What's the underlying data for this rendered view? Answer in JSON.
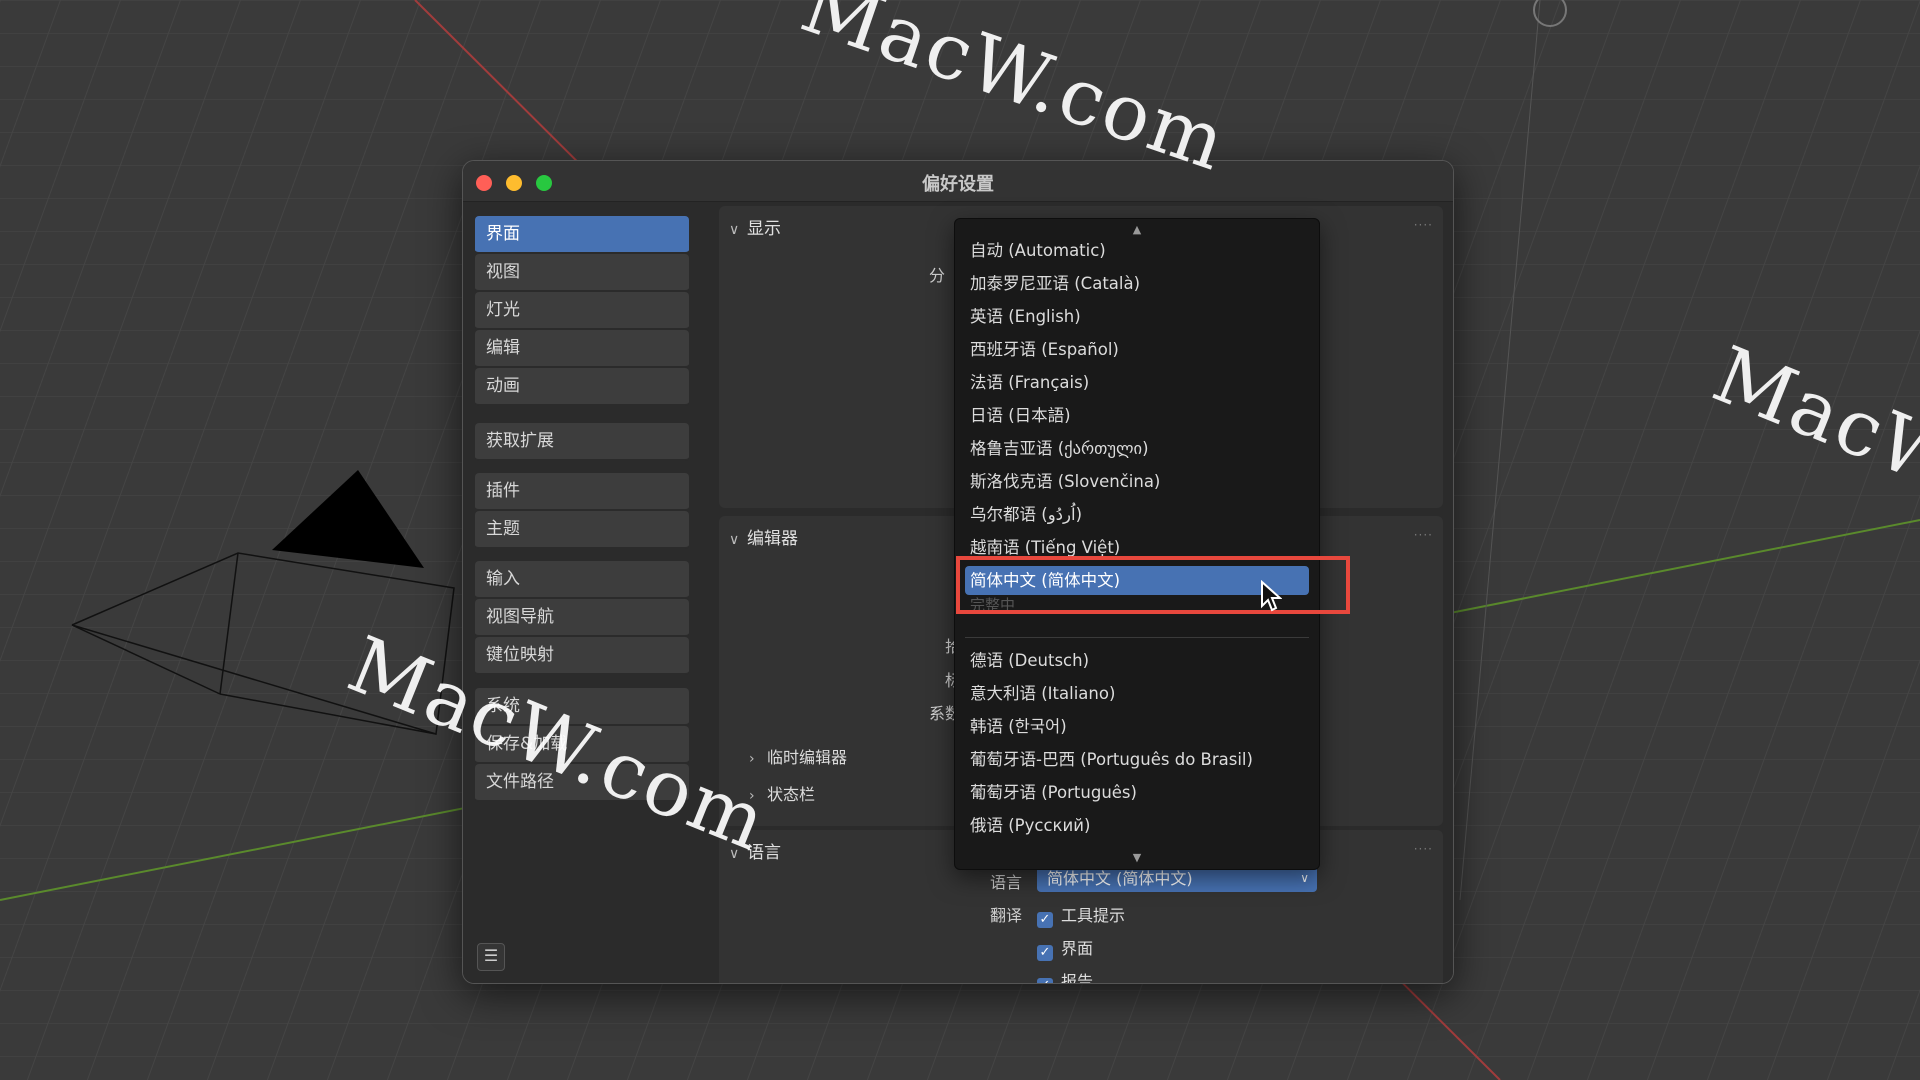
{
  "window": {
    "title": "偏好设置"
  },
  "sidebar": {
    "groups": [
      [
        "界面",
        "视图",
        "灯光",
        "编辑",
        "动画"
      ],
      [
        "获取扩展"
      ],
      [
        "插件",
        "主题"
      ],
      [
        "输入",
        "视图导航",
        "键位映射"
      ],
      [
        "系统",
        "保存&加载",
        "文件路径"
      ]
    ],
    "active": "界面"
  },
  "main": {
    "display": {
      "title": "显示",
      "label_partial": "分"
    },
    "editors": {
      "title": "编辑器",
      "labels_partial": [
        "拾",
        "标",
        "系数"
      ],
      "sub_temp": "临时编辑器",
      "sub_status": "状态栏"
    },
    "language": {
      "title": "语言",
      "label_language": "语言",
      "selected": "简体中文 (简体中文)",
      "label_translate": "翻译",
      "cb_tooltips": "工具提示",
      "cb_interface": "界面",
      "cb_reports": "报告"
    }
  },
  "dropdown": {
    "options": [
      "自动 (Automatic)",
      "加泰罗尼亚语 (Català)",
      "英语 (English)",
      "西班牙语 (Español)",
      "法语 (Français)",
      "日语 (日本語)",
      "格鲁吉亚语 (ქართული)",
      "斯洛伐克语 (Slovenčina)",
      "乌尔都语 (اُردُو)",
      "越南语 (Tiếng Việt)"
    ],
    "selected": "简体中文 (简体中文)",
    "faded": "完整中",
    "options_after": [
      "德语 (Deutsch)",
      "意大利语 (Italiano)",
      "韩语 (한국어)",
      "葡萄牙语-巴西 (Português do Brasil)",
      "葡萄牙语 (Português)",
      "俄语 (Русский)"
    ]
  },
  "watermarks": [
    "MacW.com",
    "MacW.com",
    "MacW.c"
  ]
}
